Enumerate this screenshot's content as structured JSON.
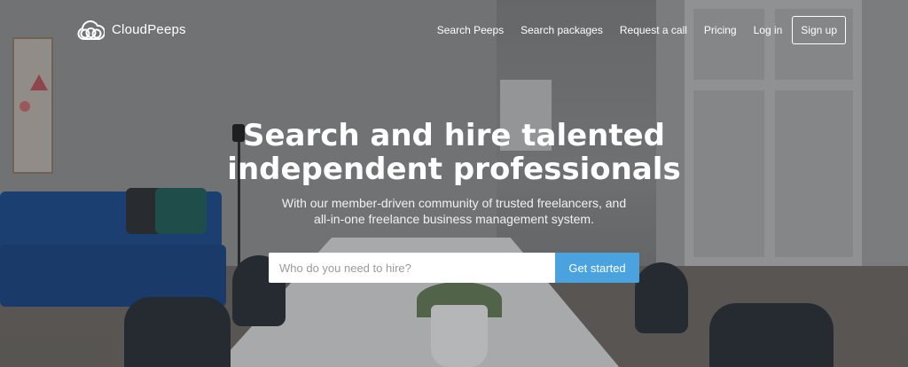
{
  "brand": {
    "name": "CloudPeeps",
    "icon": "cloud-logo-icon"
  },
  "nav": {
    "links": [
      {
        "label": "Search Peeps"
      },
      {
        "label": "Search packages"
      },
      {
        "label": "Request a call"
      },
      {
        "label": "Pricing"
      },
      {
        "label": "Log in"
      }
    ],
    "signup_label": "Sign up"
  },
  "hero": {
    "headline_line1": "Search and hire talented",
    "headline_line2": "independent professionals",
    "subhead_line1": "With our member-driven community of trusted freelancers, and",
    "subhead_line2": "all-in-one freelance business management system."
  },
  "search": {
    "value": "",
    "placeholder": "Who do you need to hire?",
    "button_label": "Get started"
  },
  "colors": {
    "accent": "#4aa3df",
    "text": "#ffffff"
  }
}
